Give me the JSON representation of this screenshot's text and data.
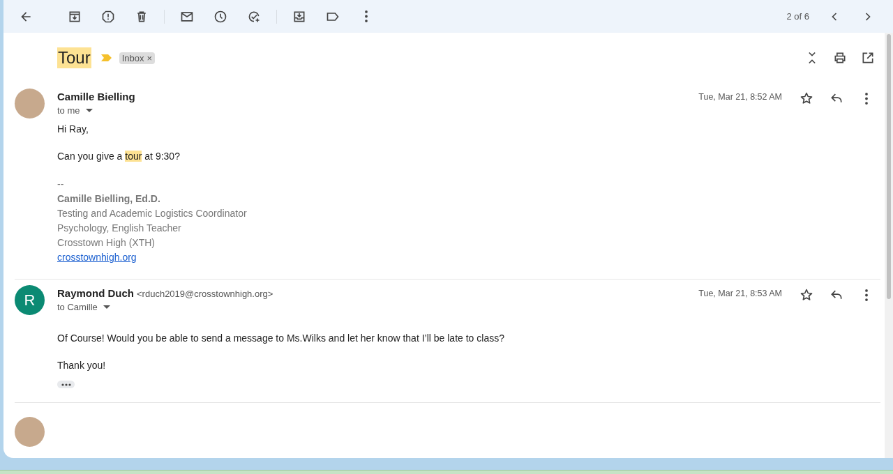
{
  "toolbar": {
    "counter": "2 of 6"
  },
  "subject": {
    "title": "Tour",
    "highlighted": true,
    "important": true,
    "labels": [
      {
        "name": "Inbox",
        "remove": "×"
      }
    ]
  },
  "messages": [
    {
      "avatar": {
        "kind": "photo"
      },
      "sender": "Camille Bielling",
      "to": "to me",
      "date": "Tue, Mar 21, 8:52 AM",
      "starred": false,
      "body": [
        {
          "kind": "text",
          "parts": [
            {
              "text": "Hi Ray,",
              "highlighted": false
            }
          ]
        },
        {
          "kind": "text",
          "parts": [
            {
              "text": "Can you give a ",
              "highlighted": false
            },
            {
              "text": "tour",
              "highlighted": true
            },
            {
              "text": " at 9:30?",
              "highlighted": false
            }
          ]
        }
      ],
      "signature": {
        "separator": "--",
        "name": "Camille Bielling, Ed.D.",
        "lines": [
          "Testing and Academic Logistics Coordinator",
          "Psychology, English Teacher",
          "Crosstown High (XTH)"
        ],
        "link": "crosstownhigh.org"
      }
    },
    {
      "avatar": {
        "kind": "letter",
        "letter": "R",
        "color": "#0b8a73"
      },
      "sender": "Raymond Duch",
      "email": "<rduch2019@crosstownhigh.org>",
      "to": "to Camille",
      "date": "Tue, Mar 21, 8:53 AM",
      "starred": false,
      "body": [
        {
          "kind": "text",
          "parts": [
            {
              "text": "Of Course! Would you be able to send a message to Ms.Wilks and let her know that I’ll be late to class?",
              "highlighted": false
            }
          ]
        },
        {
          "kind": "text",
          "parts": [
            {
              "text": "Thank you!",
              "highlighted": false
            }
          ]
        }
      ],
      "trimmed": true
    }
  ]
}
